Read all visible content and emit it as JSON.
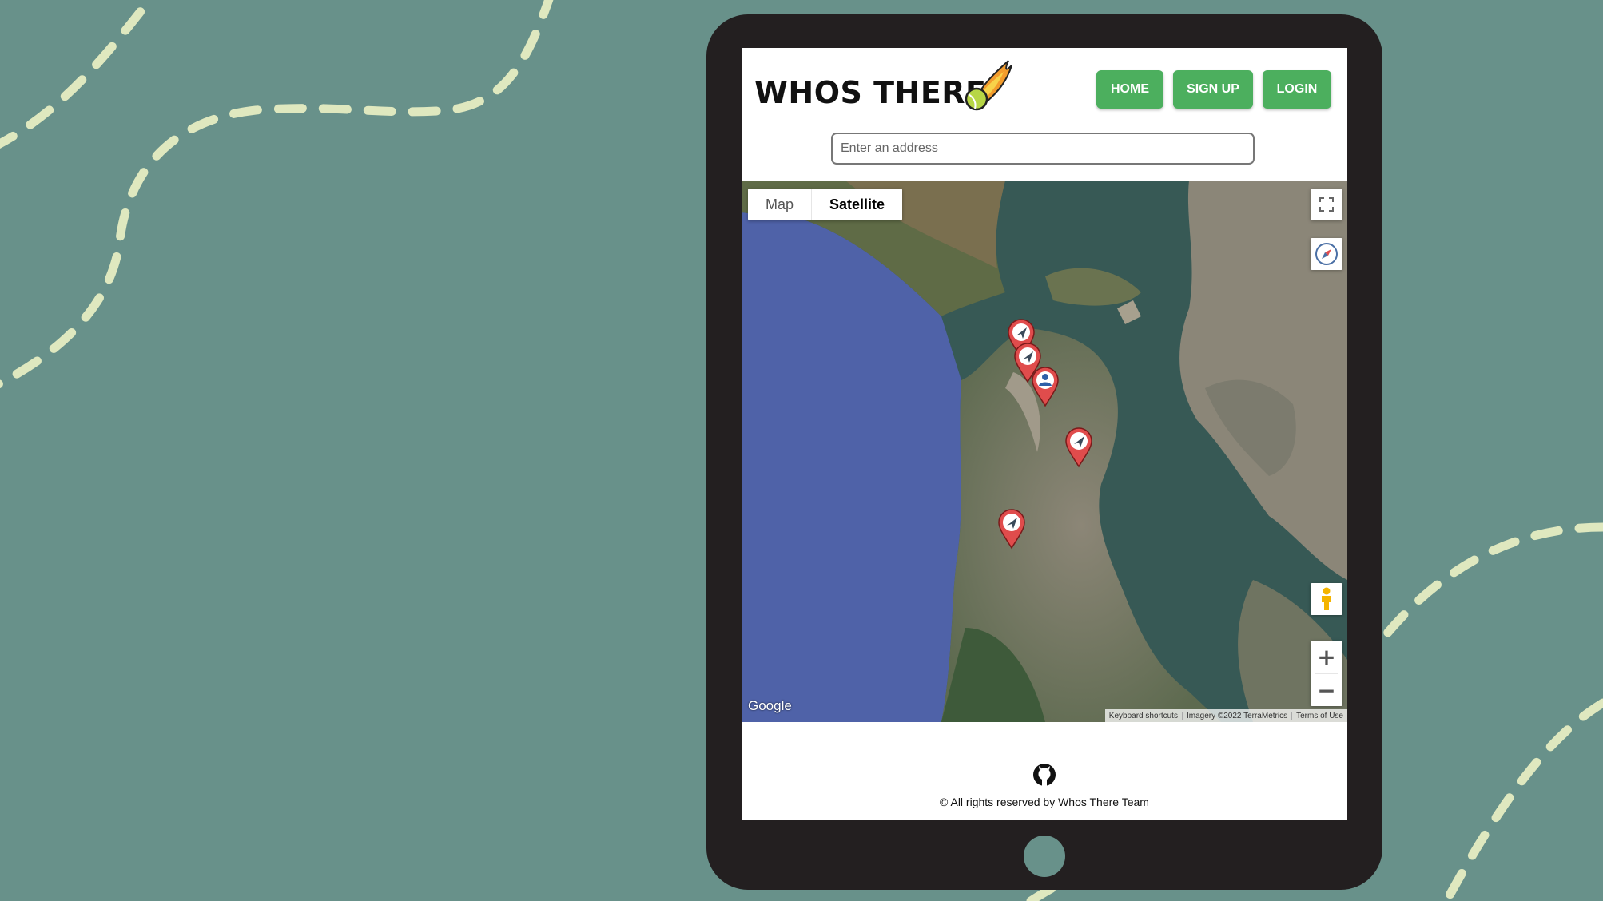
{
  "app": {
    "brand": "WHOS THERE",
    "nav": {
      "home": "HOME",
      "signup": "SIGN UP",
      "login": "LOGIN"
    },
    "search": {
      "placeholder": "Enter an address",
      "value": ""
    }
  },
  "map": {
    "type_controls": {
      "map": "Map",
      "satellite": "Satellite",
      "selected": "Satellite"
    },
    "controls": {
      "zoom_in": "+",
      "zoom_out": "−"
    },
    "logo": "Google",
    "attribution": [
      "Keyboard shortcuts",
      "Imagery ©2022 TerraMetrics",
      "Terms of Use"
    ],
    "markers": [
      {
        "kind": "send-arrow"
      },
      {
        "kind": "send-arrow"
      },
      {
        "kind": "user"
      },
      {
        "kind": "send-arrow"
      },
      {
        "kind": "send-arrow"
      }
    ]
  },
  "footer": {
    "text": "© All rights reserved by Whos There Team"
  },
  "colors": {
    "background": "#68918a",
    "tablet": "#231f20",
    "accent": "#4caf5e",
    "marker": "#e04c4c",
    "dashes": "#dfe8bf"
  }
}
